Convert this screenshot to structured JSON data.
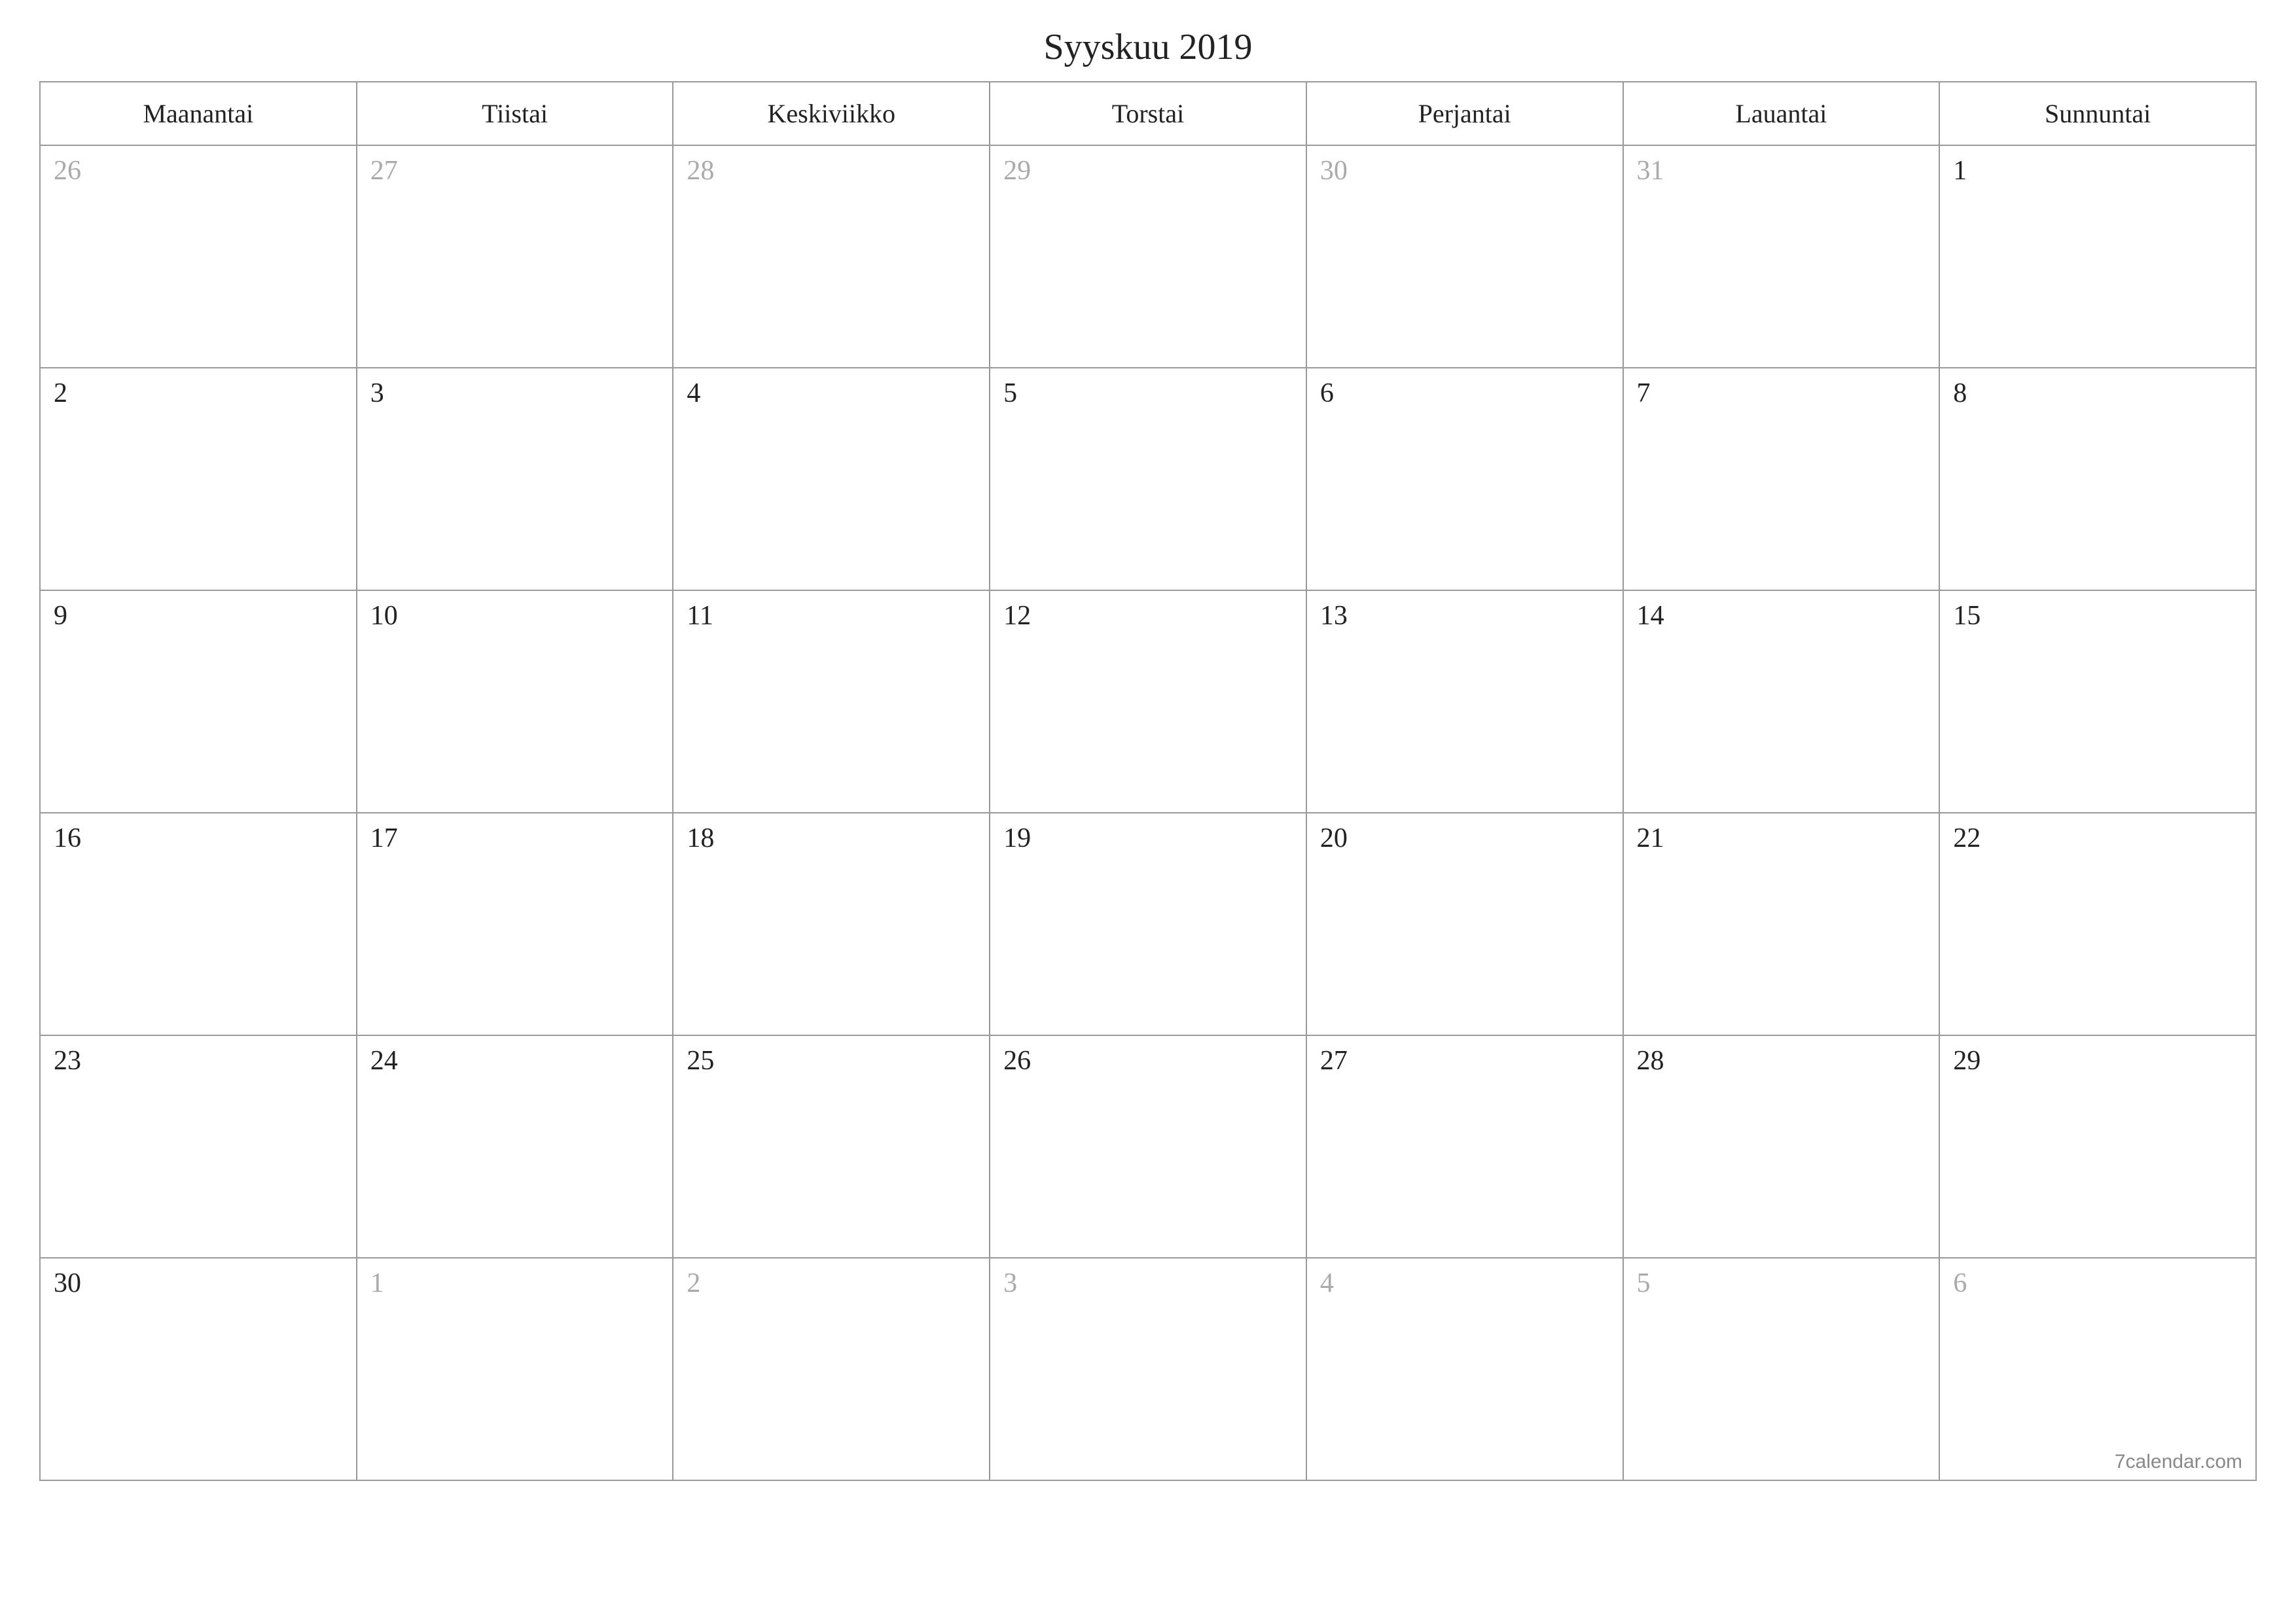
{
  "title": "Syyskuu 2019",
  "weekdays": [
    "Maanantai",
    "Tiistai",
    "Keskiviikko",
    "Torstai",
    "Perjantai",
    "Lauantai",
    "Sunnuntai"
  ],
  "weeks": [
    [
      {
        "day": "26",
        "other": true
      },
      {
        "day": "27",
        "other": true
      },
      {
        "day": "28",
        "other": true
      },
      {
        "day": "29",
        "other": true
      },
      {
        "day": "30",
        "other": true
      },
      {
        "day": "31",
        "other": true
      },
      {
        "day": "1",
        "other": false
      }
    ],
    [
      {
        "day": "2",
        "other": false
      },
      {
        "day": "3",
        "other": false
      },
      {
        "day": "4",
        "other": false
      },
      {
        "day": "5",
        "other": false
      },
      {
        "day": "6",
        "other": false
      },
      {
        "day": "7",
        "other": false
      },
      {
        "day": "8",
        "other": false
      }
    ],
    [
      {
        "day": "9",
        "other": false
      },
      {
        "day": "10",
        "other": false
      },
      {
        "day": "11",
        "other": false
      },
      {
        "day": "12",
        "other": false
      },
      {
        "day": "13",
        "other": false
      },
      {
        "day": "14",
        "other": false
      },
      {
        "day": "15",
        "other": false
      }
    ],
    [
      {
        "day": "16",
        "other": false
      },
      {
        "day": "17",
        "other": false
      },
      {
        "day": "18",
        "other": false
      },
      {
        "day": "19",
        "other": false
      },
      {
        "day": "20",
        "other": false
      },
      {
        "day": "21",
        "other": false
      },
      {
        "day": "22",
        "other": false
      }
    ],
    [
      {
        "day": "23",
        "other": false
      },
      {
        "day": "24",
        "other": false
      },
      {
        "day": "25",
        "other": false
      },
      {
        "day": "26",
        "other": false
      },
      {
        "day": "27",
        "other": false
      },
      {
        "day": "28",
        "other": false
      },
      {
        "day": "29",
        "other": false
      }
    ],
    [
      {
        "day": "30",
        "other": false
      },
      {
        "day": "1",
        "other": true
      },
      {
        "day": "2",
        "other": true
      },
      {
        "day": "3",
        "other": true
      },
      {
        "day": "4",
        "other": true
      },
      {
        "day": "5",
        "other": true
      },
      {
        "day": "6",
        "other": true
      }
    ]
  ],
  "credit": "7calendar.com"
}
